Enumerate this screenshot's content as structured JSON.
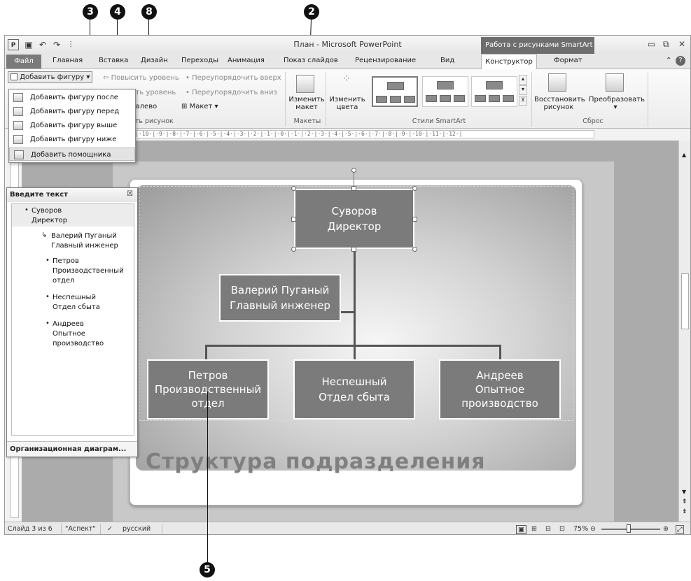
{
  "callouts": [
    "3",
    "4",
    "8",
    "2",
    "5"
  ],
  "titlebar": {
    "title": "План - Microsoft PowerPoint",
    "context_header": "Работа с рисунками SmartArt",
    "minimize": "▭",
    "restore": "⧉",
    "close": "✕"
  },
  "tabs": {
    "file": "Файл",
    "home": "Главная",
    "insert": "Вставка",
    "design": "Дизайн",
    "transitions": "Переходы",
    "animation": "Анимация",
    "slideshow": "Показ слайдов",
    "review": "Рецензирование",
    "view": "Вид",
    "constructor": "Конструктор",
    "format": "Формат"
  },
  "ribbon": {
    "add_shape": "Добавить фигуру",
    "promote": "Повысить уровень",
    "move_up": "Переупорядочить вверх",
    "demote": "ить уровень",
    "move_down": "Переупорядочить вниз",
    "rtl": "налево",
    "layout": "Макет ▾",
    "create_graphic_group": "ать рисунок",
    "change_layout": "Изменить макет",
    "layouts_group": "Макеты",
    "change_colors": "Изменить цвета",
    "smartart_styles_group": "Стили SmartArt",
    "reset_graphic": "Восстановить рисунок",
    "convert": "Преобразовать",
    "reset_group": "Сброс"
  },
  "dropdown": {
    "items": [
      "Добавить фигуру после",
      "Добавить фигуру перед",
      "Добавить фигуру выше",
      "Добавить фигуру ниже",
      "Добавить помощника"
    ]
  },
  "ruler_text": "·11·|·10·|·9·|·8·|·7·|·6·|·5·|·4·|·3·|·2·|·1·|·0·|·1·|·2·|·3·|·4·|·5·|·6·|·7·|·8·|·9·|·10·|·11·|·12·|",
  "text_pane": {
    "title": "Введите текст",
    "close": "☒",
    "items": [
      {
        "line1": "Суворов",
        "line2": "Директор"
      },
      {
        "line1": "Валерий Пуганый",
        "line2": "Главный инженер"
      },
      {
        "line1": "Петров",
        "line2": "Производственный",
        "line3": "отдел"
      },
      {
        "line1": "Неспешный",
        "line2": "Отдел сбыта"
      },
      {
        "line1": "Андреев",
        "line2": "Опытное",
        "line3": "производство"
      }
    ],
    "footer": "Организационная диаграм..."
  },
  "org_chart": {
    "top": {
      "line1": "Суворов",
      "line2": "Директор"
    },
    "assistant": {
      "line1": "Валерий Пуганый",
      "line2": "Главный инженер"
    },
    "children": [
      {
        "line1": "Петров",
        "line2": "Производственный",
        "line3": "отдел"
      },
      {
        "line1": "Неспешный",
        "line2": "Отдел сбыта"
      },
      {
        "line1": "Андреев",
        "line2": "Опытное",
        "line3": "производство"
      }
    ]
  },
  "slide_title": "Структура подразделения",
  "status": {
    "slide": "Слайд 3 из 6",
    "theme": "\"Аспект\"",
    "language": "русский",
    "zoom": "75%"
  },
  "colors": {
    "node_fill": "#7b7b7b",
    "context_tab": "#6e6e6e",
    "title_text": "#7f7f7f"
  }
}
